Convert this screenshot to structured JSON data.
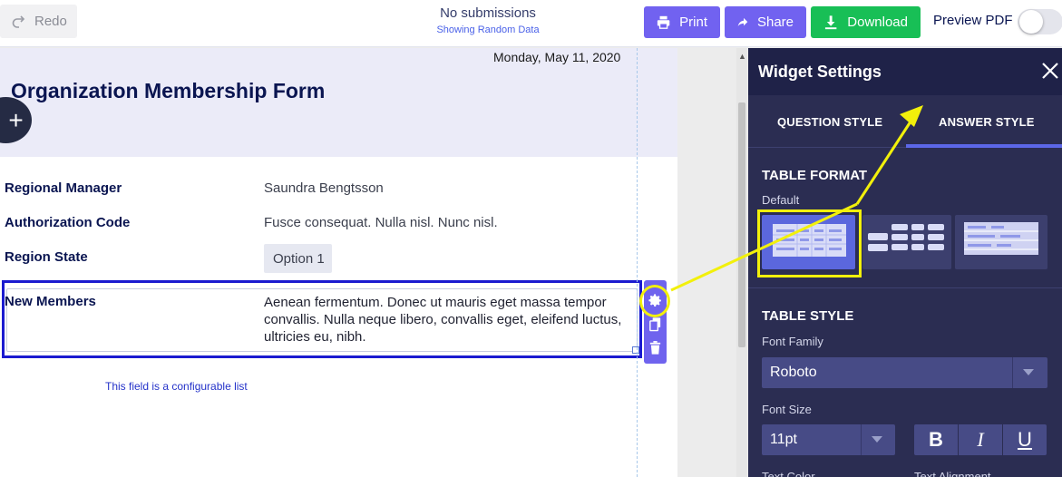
{
  "toolbar": {
    "redo_label": "Redo",
    "submissions_title": "No submissions",
    "submissions_subtitle": "Showing Random Data",
    "print_label": "Print",
    "share_label": "Share",
    "download_label": "Download",
    "preview_label": "Preview PDF",
    "preview_enabled": false
  },
  "form": {
    "date": "Monday, May 11, 2020",
    "title": "Organization Membership Form",
    "fields": [
      {
        "label": "Regional Manager",
        "value": "Saundra Bengtsson"
      },
      {
        "label": "Authorization Code",
        "value": "Fusce consequat. Nulla nisl. Nunc nisl."
      },
      {
        "label": "Region State",
        "value": "Option 1"
      }
    ],
    "selected_field": {
      "label": "New Members",
      "value": "Aenean fermentum. Donec ut mauris eget massa tempor convallis. Nulla neque libero, convallis eget, eleifend luctus, ultricies eu, nibh."
    },
    "configurable_note": "This field is a configurable list"
  },
  "widget_settings": {
    "title": "Widget Settings",
    "tabs": [
      "QUESTION STYLE",
      "ANSWER STYLE"
    ],
    "active_tab": "ANSWER STYLE",
    "table_format": {
      "heading": "TABLE FORMAT",
      "selected": "Default"
    },
    "table_style": {
      "heading": "TABLE STYLE",
      "font_family_label": "Font Family",
      "font_family": "Roboto",
      "font_size_label": "Font Size",
      "font_size": "11pt",
      "bold": "B",
      "italic": "I",
      "underline": "U",
      "text_color_label": "Text Color",
      "text_alignment_label": "Text Alignment"
    }
  },
  "colors": {
    "accent_purple": "#7162f0",
    "download_green": "#18bf56",
    "panel_bg": "#2b2d52",
    "annotation_yellow": "#f2f00b",
    "selection_blue": "#1a1ad0"
  }
}
